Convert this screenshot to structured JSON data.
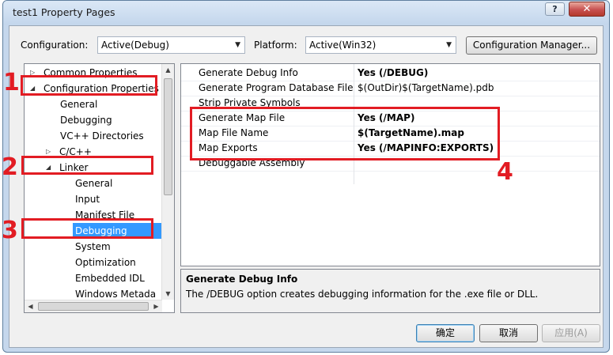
{
  "window": {
    "title": "test1 Property Pages",
    "help": "?",
    "close": "✕"
  },
  "config_bar": {
    "configuration_label": "Configuration:",
    "configuration_value": "Active(Debug)",
    "platform_label": "Platform:",
    "platform_value": "Active(Win32)",
    "config_manager_label": "Configuration Manager..."
  },
  "tree": {
    "items": [
      {
        "label": "Common Properties",
        "twisty": "▷"
      },
      {
        "label": "Configuration Properties",
        "twisty": "◢"
      },
      {
        "label": "General"
      },
      {
        "label": "Debugging"
      },
      {
        "label": "VC++ Directories"
      },
      {
        "label": "C/C++",
        "twisty": "▷"
      },
      {
        "label": "Linker",
        "twisty": "◢"
      },
      {
        "label": "General"
      },
      {
        "label": "Input"
      },
      {
        "label": "Manifest File"
      },
      {
        "label": "Debugging",
        "selected": true
      },
      {
        "label": "System"
      },
      {
        "label": "Optimization"
      },
      {
        "label": "Embedded IDL"
      },
      {
        "label": "Windows Metada"
      }
    ]
  },
  "properties": [
    {
      "name": "Generate Debug Info",
      "value": "Yes (/DEBUG)",
      "bold": true
    },
    {
      "name": "Generate Program Database File",
      "value": "$(OutDir)$(TargetName).pdb",
      "bold": false
    },
    {
      "name": "Strip Private Symbols",
      "value": "",
      "bold": false
    },
    {
      "name": "Generate Map File",
      "value": "Yes (/MAP)",
      "bold": true
    },
    {
      "name": "Map File Name",
      "value": "$(TargetName).map",
      "bold": true
    },
    {
      "name": "Map Exports",
      "value": "Yes (/MAPINFO:EXPORTS)",
      "bold": true
    },
    {
      "name": "Debuggable Assembly",
      "value": "",
      "bold": false
    }
  ],
  "description": {
    "title": "Generate Debug Info",
    "text": "The /DEBUG option creates debugging information for the .exe file or DLL."
  },
  "buttons": {
    "ok": "确定",
    "cancel": "取消",
    "apply": "应用(A)"
  },
  "annotations": {
    "n1": "1",
    "n2": "2",
    "n3": "3",
    "n4": "4",
    "color": "#e21c23"
  },
  "colors": {
    "selection": "#3399ff",
    "accent_red": "#e21c23"
  }
}
